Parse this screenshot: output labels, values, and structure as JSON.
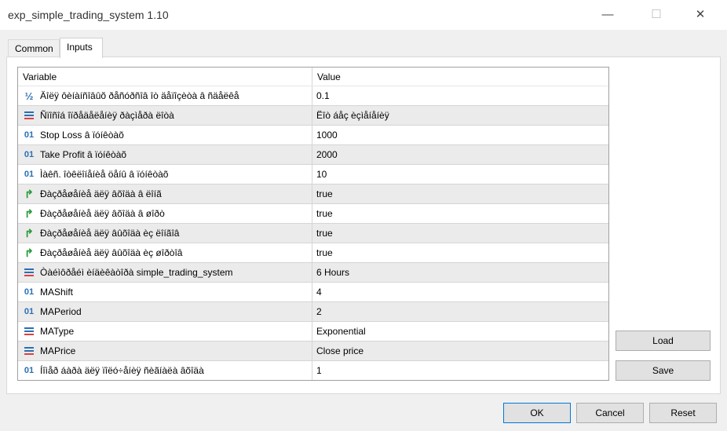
{
  "window": {
    "title": "exp_simple_trading_system 1.10",
    "minimize": "—",
    "maximize": "☐",
    "close": "✕"
  },
  "tabs": [
    {
      "label": "Common",
      "active": false
    },
    {
      "label": "Inputs",
      "active": true
    }
  ],
  "table": {
    "headers": [
      "Variable",
      "Value"
    ],
    "rows": [
      {
        "icon": "double",
        "variable": "Äîëÿ ôèíàíñîâûõ ðåñóðñîâ îò äåïîçèòà â ñäåëêå",
        "value": "0.1"
      },
      {
        "icon": "enum",
        "variable": "Ñïîñîá îïðåäåëåíèÿ ðàçìåðà ëîòà",
        "value": "Ëîò áåç èçìåíåíèÿ"
      },
      {
        "icon": "int",
        "variable": "Stop Loss â ïóíêòàõ",
        "value": "1000"
      },
      {
        "icon": "int",
        "variable": "Take Profit â ïóíêòàõ",
        "value": "2000"
      },
      {
        "icon": "int",
        "variable": "Ìàêñ. îòêëîíåíèå öåíû â ïóíêòàõ",
        "value": "10"
      },
      {
        "icon": "bool",
        "variable": "Ðàçðåøåíèå äëÿ âõîäà â ëîíã",
        "value": "true"
      },
      {
        "icon": "bool",
        "variable": "Ðàçðåøåíèå äëÿ âõîäà â øîðò",
        "value": "true"
      },
      {
        "icon": "bool",
        "variable": "Ðàçðåøåíèå äëÿ âûõîäà èç ëîíãîâ",
        "value": "true"
      },
      {
        "icon": "bool",
        "variable": "Ðàçðåøåíèå äëÿ âûõîäà èç øîðòîâ",
        "value": "true"
      },
      {
        "icon": "enum",
        "variable": "Òàéìôðåéì èíäèêàòîðà simple_trading_system",
        "value": "6 Hours"
      },
      {
        "icon": "int",
        "variable": "MAShift",
        "value": "4"
      },
      {
        "icon": "int",
        "variable": "MAPeriod",
        "value": "2"
      },
      {
        "icon": "enum",
        "variable": "MAType",
        "value": "Exponential"
      },
      {
        "icon": "enum",
        "variable": "MAPrice",
        "value": "Close price"
      },
      {
        "icon": "int",
        "variable": "Íîìåð áàðà äëÿ ïîëó÷åíèÿ ñèãíàëà âõîäà",
        "value": "1"
      }
    ]
  },
  "buttons": {
    "load": "Load",
    "save": "Save",
    "ok": "OK",
    "cancel": "Cancel",
    "reset": "Reset"
  },
  "icon_glyphs": {
    "double": "½",
    "int": "01",
    "bool": "↱"
  },
  "colors": {
    "enum_blue": "#2a6fb5",
    "enum_red": "#e04040",
    "bool_green": "#2a9a3a",
    "alt_row": "#ebebeb",
    "default_button_border": "#0078d7"
  }
}
